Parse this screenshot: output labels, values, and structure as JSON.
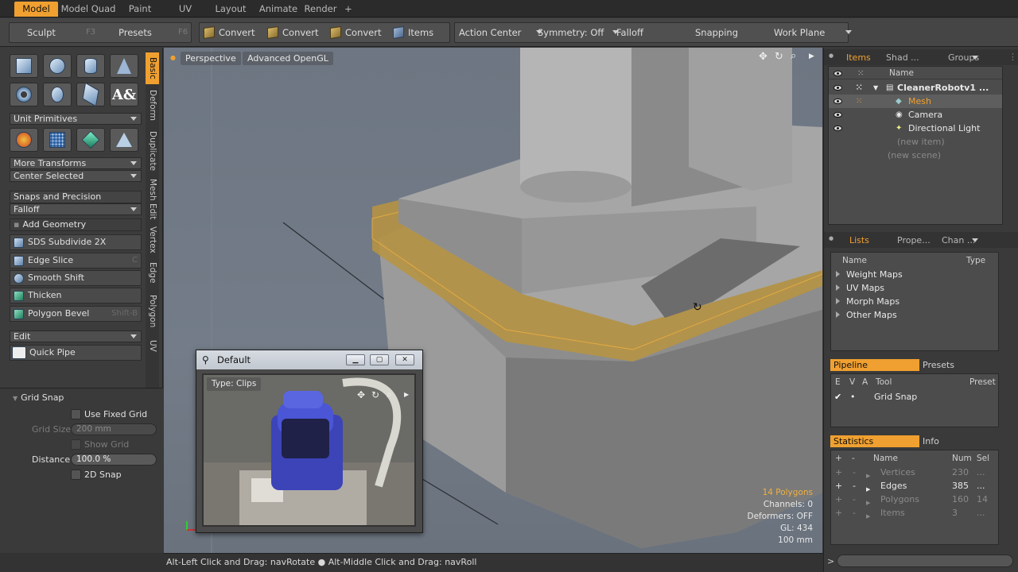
{
  "top_tabs": [
    "Model",
    "Model Quad",
    "Paint",
    "UV",
    "Layout",
    "Animate",
    "Render",
    "+"
  ],
  "toolbar": {
    "sculpt": "Sculpt",
    "sculpt_key": "F3",
    "presets": "Presets",
    "presets_key": "F6",
    "convert1": "Convert",
    "convert2": "Convert",
    "convert3": "Convert",
    "items": "Items",
    "action_center": "Action Center",
    "symmetry": "Symmetry: Off",
    "falloff": "Falloff",
    "snapping": "Snapping",
    "work_plane": "Work Plane"
  },
  "left": {
    "unit_primitives": "Unit Primitives",
    "more_transforms": "More Transforms",
    "center_selected": "Center Selected",
    "snaps_precision": "Snaps and Precision",
    "falloff": "Falloff",
    "add_geometry": "Add Geometry",
    "buttons": [
      {
        "label": "SDS Subdivide 2X",
        "key": ""
      },
      {
        "label": "Edge Slice",
        "key": "C"
      },
      {
        "label": "Smooth Shift",
        "key": ""
      },
      {
        "label": "Thicken",
        "key": ""
      },
      {
        "label": "Polygon Bevel",
        "key": "Shift-B"
      }
    ],
    "edit": "Edit",
    "quick_pipe": "Quick Pipe",
    "vtabs": [
      "Basic",
      "Deform",
      "Duplicate",
      "Mesh Edit",
      "Vertex",
      "Edge",
      "Polygon",
      "UV"
    ]
  },
  "grid_snap": {
    "title": "Grid Snap",
    "use_fixed_grid": "Use Fixed Grid",
    "grid_size_label": "Grid Size",
    "grid_size_value": "200 mm",
    "show_grid": "Show Grid",
    "distance_label": "Distance",
    "distance_value": "100.0 %",
    "snap_2d": "2D Snap"
  },
  "viewport": {
    "perspective": "Perspective",
    "renderer": "Advanced OpenGL",
    "stats": {
      "polygons": "14 Polygons",
      "channels": "Channels: 0",
      "deformers": "Deformers: OFF",
      "gl": "GL: 434",
      "scale": "100 mm"
    }
  },
  "status_bar": "Alt-Left Click and Drag: navRotate ● Alt-Middle Click and Drag: navRoll",
  "float_window": {
    "title": "Default",
    "clip_label": "Type: Clips"
  },
  "items_panel": {
    "tabs": [
      "Items",
      "Shad ...",
      "Groups"
    ],
    "header_name": "Name",
    "scene": "CleanerRobotv1 ...",
    "mesh": "Mesh",
    "camera": "Camera",
    "light": "Directional Light",
    "new_item": "(new item)",
    "new_scene": "(new scene)"
  },
  "lists_panel": {
    "tabs": [
      "Lists",
      "Prope...",
      "Chan ..."
    ],
    "header_name": "Name",
    "header_type": "Type",
    "rows": [
      "Weight Maps",
      "UV Maps",
      "Morph Maps",
      "Other Maps"
    ]
  },
  "pipeline_panel": {
    "tabs": [
      "Pipeline",
      "Presets"
    ],
    "headers": [
      "E",
      "V",
      "A",
      "Tool",
      "Preset"
    ],
    "tool": "Grid Snap",
    "check": "✔",
    "dot": "•"
  },
  "statistics_panel": {
    "tabs": [
      "Statistics",
      "Info"
    ],
    "headers": [
      "+",
      "-",
      "Name",
      "Num",
      "Sel"
    ],
    "rows": [
      {
        "name": "Vertices",
        "num": "230",
        "sel": "...",
        "dim": true
      },
      {
        "name": "Edges",
        "num": "385",
        "sel": "...",
        "dim": false
      },
      {
        "name": "Polygons",
        "num": "160",
        "sel": "14",
        "dim": true
      },
      {
        "name": "Items",
        "num": "3",
        "sel": "...",
        "dim": true
      }
    ]
  },
  "command_prompt": ">",
  "colors": {
    "accent": "#f0a030",
    "selection": "#f0a030"
  }
}
